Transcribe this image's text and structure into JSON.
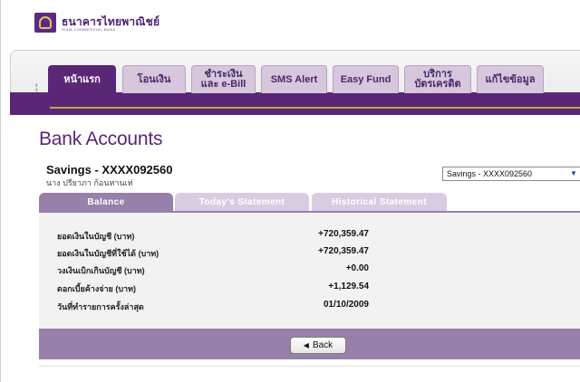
{
  "brand": {
    "name_th": "ธนาคารไทยพาณิชย์",
    "name_en": "SIAM COMMERCIAL BANK"
  },
  "nav": {
    "marker": "¦",
    "tabs": [
      {
        "label": "หน้าแรก",
        "active": true
      },
      {
        "label": "โอนเงิน",
        "active": false
      },
      {
        "label": "ชำระเงิน\nและ e-Bill",
        "active": false
      },
      {
        "label": "SMS Alert",
        "active": false
      },
      {
        "label": "Easy Fund",
        "active": false
      },
      {
        "label": "บริการ\nบัตรเครดิต",
        "active": false
      },
      {
        "label": "แก้ไขข้อมูล",
        "active": false
      }
    ]
  },
  "page": {
    "title": "Bank Accounts"
  },
  "account": {
    "name": "Savings - XXXX092560",
    "holder": "นาง ปรียาภา ก้อนหานเท่",
    "select_value": "Savings - XXXX092560"
  },
  "statement_tabs": [
    {
      "label": "Balance",
      "active": true
    },
    {
      "label": "Today's Statement",
      "active": false
    },
    {
      "label": "Historical Statement",
      "active": false
    }
  ],
  "details": [
    {
      "label": "ยอดเงินในบัญชี (บาท)",
      "value": "+720,359.47"
    },
    {
      "label": "ยอดเงินในบัญชีที่ใช้ได้ (บาท)",
      "value": "+720,359.47"
    },
    {
      "label": "วงเงินเบิกเกินบัญชี (บาท)",
      "value": "+0.00"
    },
    {
      "label": "ดอกเบี้ยค้างจ่าย (บาท)",
      "value": "+1,129.54"
    },
    {
      "label": "วันที่ทำรายการครั้งล่าสุด",
      "value": "01/10/2009"
    }
  ],
  "actions": {
    "back_label": "Back"
  },
  "colors": {
    "brand_purple": "#5a2676",
    "tab_purple": "#9780a9",
    "gold": "#c9a14a"
  }
}
